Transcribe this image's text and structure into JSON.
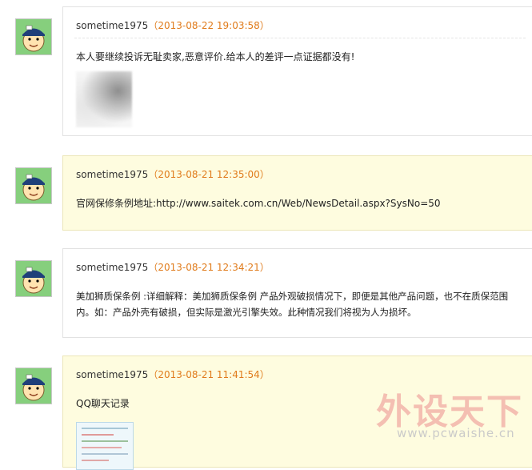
{
  "comments": [
    {
      "user": "sometime1975",
      "open_paren": "（",
      "time": "2013-08-22 19:03:58",
      "close_paren": "）",
      "text": "本人要继续投诉无耻卖家,恶意评价.给本人的差评一点证据都没有!"
    },
    {
      "user": "sometime1975",
      "open_paren": "（",
      "time": "2013-08-21 12:35:00",
      "close_paren": "）",
      "text": "官网保修条例地址:http://www.saitek.com.cn/Web/NewsDetail.aspx?SysNo=50"
    },
    {
      "user": "sometime1975",
      "open_paren": "（",
      "time": "2013-08-21 12:34:21",
      "close_paren": "）",
      "text": "美加狮质保条例 :详细解释：美加狮质保条例 产品外观破损情况下，即便是其他产品问题，也不在质保范围内。如：产品外壳有破损，但实际是激光引擎失效。此种情况我们将视为人为损坏。"
    },
    {
      "user": "sometime1975",
      "open_paren": "（",
      "time": "2013-08-21 11:41:54",
      "close_paren": "）",
      "text": "QQ聊天记录"
    }
  ],
  "watermark": {
    "title": "外设天下",
    "url": "www.pcwaishe.cn"
  },
  "colors": {
    "timestamp": "#e07b1b",
    "highlight_bg": "#fefcdf"
  }
}
